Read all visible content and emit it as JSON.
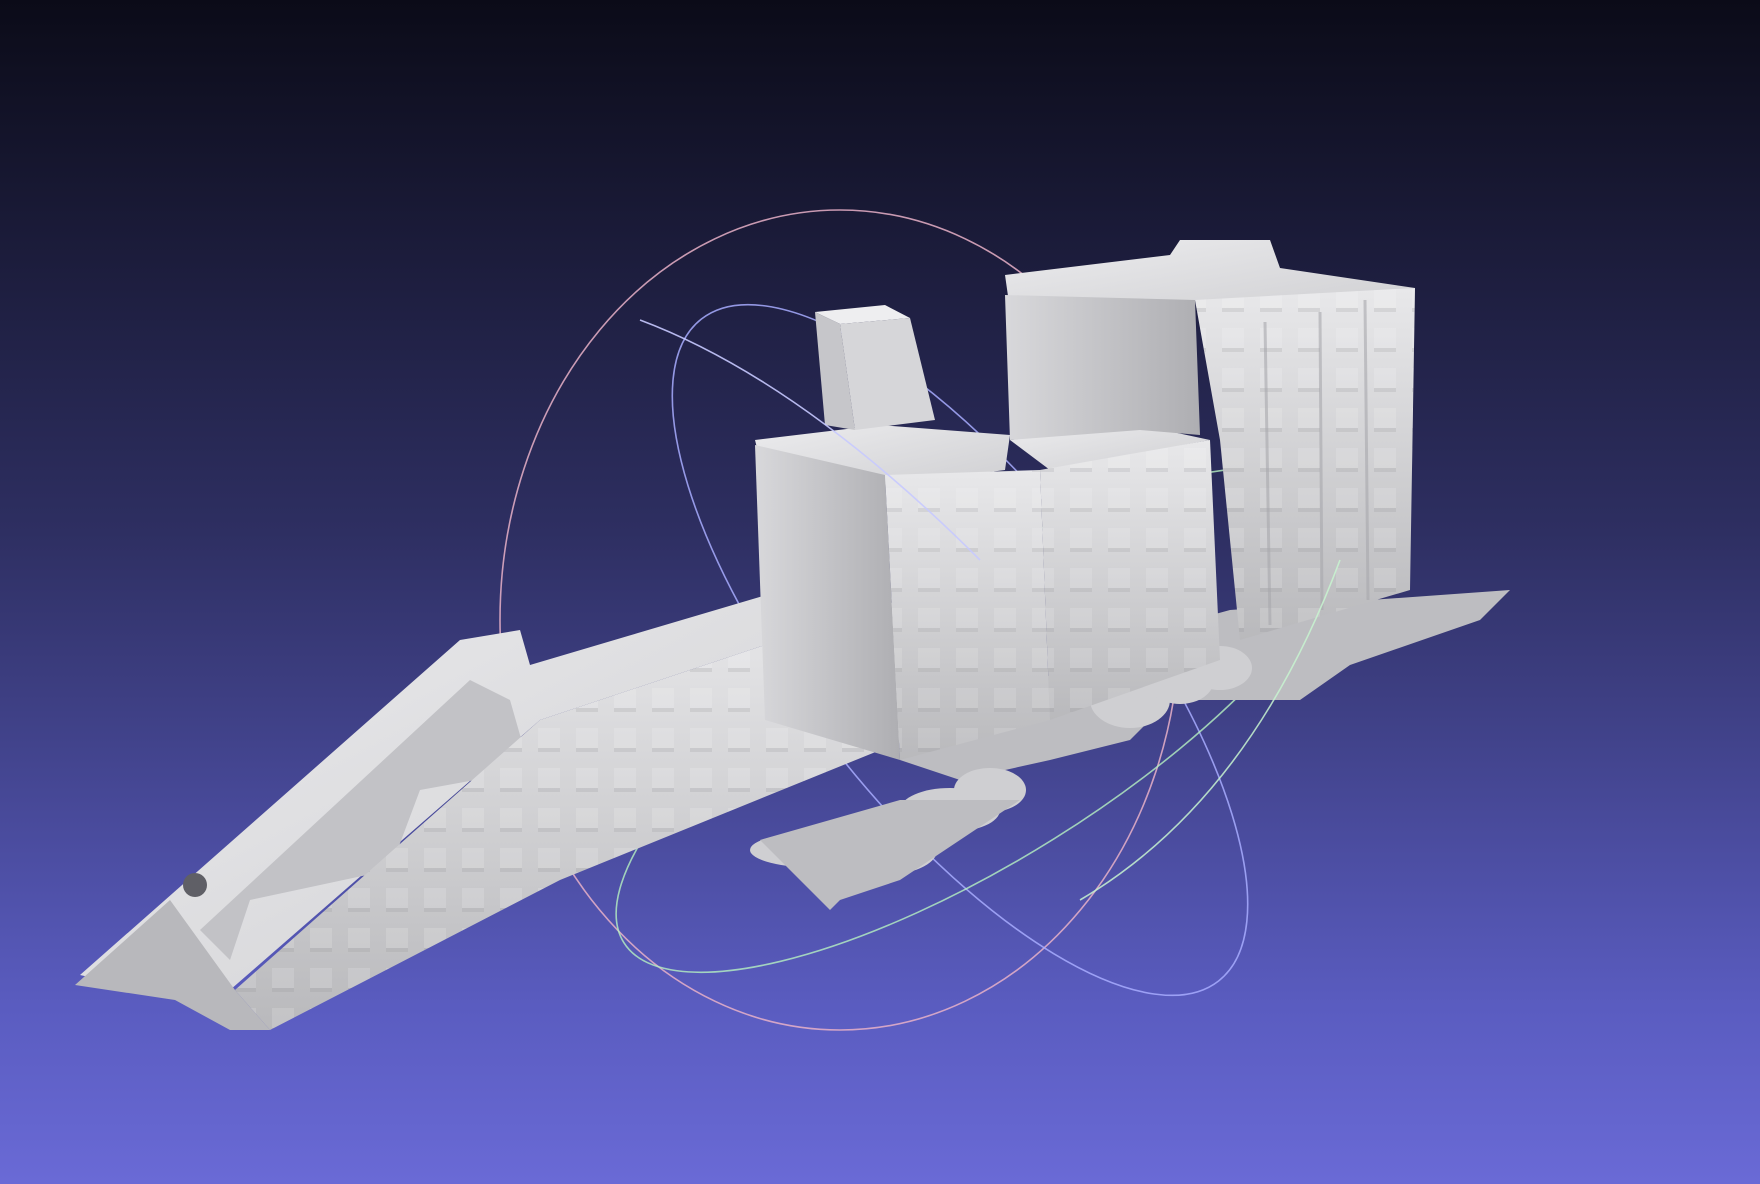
{
  "viewer": {
    "background_top": "#0b0b18",
    "background_bottom": "#6a6ad6",
    "mesh_color": "#c9c9cb",
    "trackball_colors": {
      "x_ring": "#f0b0c8",
      "y_ring": "#9fa6ff",
      "z_ring": "#a8f0b8"
    }
  }
}
